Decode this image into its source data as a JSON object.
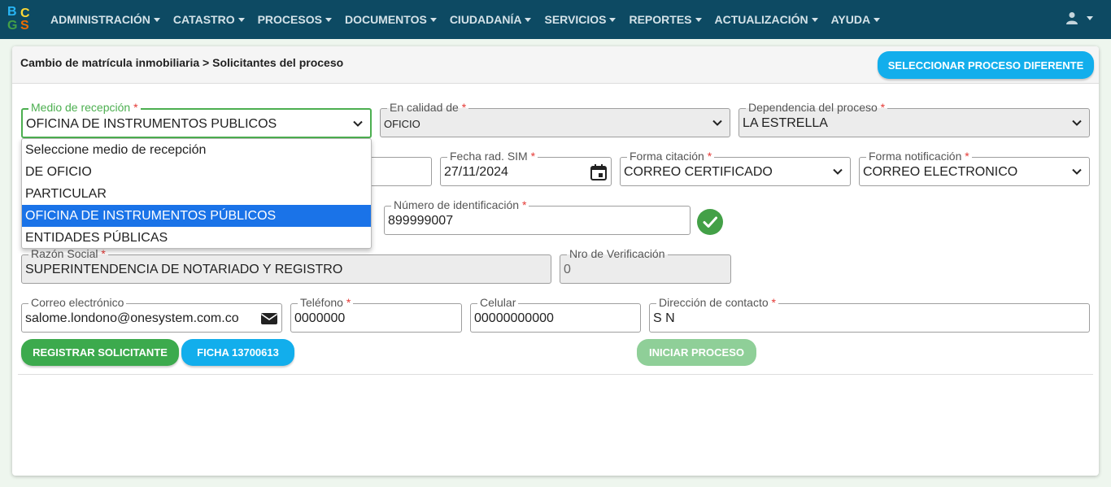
{
  "nav": {
    "logo_letters": [
      "B",
      "C",
      "G",
      "S"
    ],
    "items": [
      {
        "label": "ADMINISTRACIÓN"
      },
      {
        "label": "CATASTRO"
      },
      {
        "label": "PROCESOS"
      },
      {
        "label": "DOCUMENTOS"
      },
      {
        "label": "CIUDADANÍA"
      },
      {
        "label": "SERVICIOS"
      },
      {
        "label": "REPORTES"
      },
      {
        "label": "ACTUALIZACIÓN"
      },
      {
        "label": "AYUDA"
      }
    ],
    "user_icon": "user-icon"
  },
  "header": {
    "breadcrumb": "Cambio de matrícula inmobiliaria > Solicitantes del proceso",
    "select_other_button": "SELECCIONAR PROCESO DIFERENTE"
  },
  "form": {
    "medio_recepcion": {
      "label": "Medio de recepción",
      "value": "OFICINA DE INSTRUMENTOS PUBLICOS"
    },
    "en_calidad_de": {
      "label": "En calidad de",
      "value": "OFICIO"
    },
    "dependencia": {
      "label": "Dependencia del proceso",
      "value": "LA ESTRELLA"
    },
    "fecha_rad_sim": {
      "label": "Fecha rad. SIM",
      "value": "27/11/2024"
    },
    "forma_citacion": {
      "label": "Forma citación",
      "value": "CORREO CERTIFICADO"
    },
    "forma_notificacion": {
      "label": "Forma notificación",
      "value": "CORREO ELECTRONICO"
    },
    "numero_identificacion": {
      "label": "Número de identificación",
      "value": "899999007"
    },
    "razon_social": {
      "label": "Razón Social",
      "value": "SUPERINTENDENCIA DE NOTARIADO Y REGISTRO"
    },
    "nro_verificacion": {
      "label": "Nro de Verificación",
      "value": "0"
    },
    "correo": {
      "label": "Correo electrónico",
      "value": "salome.londono@onesystem.com.co"
    },
    "telefono": {
      "label": "Teléfono",
      "value": "0000000"
    },
    "celular": {
      "label": "Celular",
      "value": "00000000000"
    },
    "direccion": {
      "label": "Dirección de contacto",
      "value": "S N"
    },
    "required_mark": "*"
  },
  "dropdown": {
    "options": [
      {
        "label": "Seleccione medio de recepción",
        "selected": false
      },
      {
        "label": "DE OFICIO",
        "selected": false
      },
      {
        "label": "PARTICULAR",
        "selected": false
      },
      {
        "label": "OFICINA DE INSTRUMENTOS PÚBLICOS",
        "selected": true
      },
      {
        "label": "ENTIDADES PÚBLICAS",
        "selected": false
      }
    ]
  },
  "actions": {
    "registrar": "REGISTRAR SOLICITANTE",
    "ficha": "FICHA 13700613",
    "iniciar": "INICIAR PROCESO"
  },
  "colors": {
    "navbar": "#0d4a63",
    "accent_blue": "#12aeec",
    "accent_green": "#3caa4d",
    "selected_option": "#1a73e8"
  }
}
